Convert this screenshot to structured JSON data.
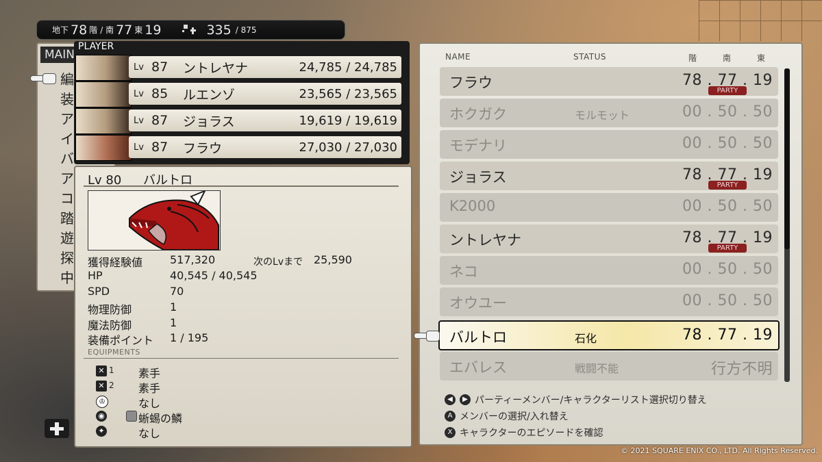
{
  "status_bar": {
    "floor_prefix": "地下",
    "floor": "78",
    "floor_suffix": "階",
    "south_prefix": "/ 南",
    "south": "77",
    "east_prefix": "東",
    "east": "19",
    "steps": "335",
    "steps_max": "/ 875"
  },
  "main_menu": {
    "header": "MAIN",
    "items": [
      "編",
      "装",
      "ア",
      "イ",
      "バ",
      "ア",
      "コ",
      "踏",
      "遊",
      "探",
      "中"
    ]
  },
  "player": {
    "label": "PLAYER",
    "rows": [
      {
        "lv_label": "Lv",
        "lv": "87",
        "name": "ントレヤナ",
        "hp": "24,785 / 24,785"
      },
      {
        "lv_label": "Lv",
        "lv": "85",
        "name": "ルエンゾ",
        "hp": "23,565 / 23,565"
      },
      {
        "lv_label": "Lv",
        "lv": "87",
        "name": "ジョラス",
        "hp": "19,619 / 19,619"
      },
      {
        "lv_label": "Lv",
        "lv": "87",
        "name": "フラウ",
        "hp": "27,030 / 27,030"
      }
    ]
  },
  "detail": {
    "lv_label": "Lv 80",
    "name": "バルトロ",
    "exp_label": "獲得経験値",
    "exp": "517,320",
    "next_label": "次のLvまで",
    "next": "25,590",
    "hp_label": "HP",
    "hp": "40,545 / 40,545",
    "spd_label": "SPD",
    "spd": "70",
    "pdef_label": "物理防御",
    "pdef": "1",
    "mdef_label": "魔法防御",
    "mdef": "1",
    "equip_pts_label": "装備ポイント",
    "equip_pts": "1 / 195",
    "equip_header": "EQUIPMENTS",
    "equips": [
      {
        "num": "1",
        "value": "素手"
      },
      {
        "num": "2",
        "value": "素手"
      },
      {
        "num": "",
        "value": "なし"
      },
      {
        "num": "",
        "value": "蜥蜴の鱗"
      },
      {
        "num": "",
        "value": "なし"
      }
    ]
  },
  "list": {
    "headers": {
      "name": "NAME",
      "status": "STATUS",
      "floor": "階",
      "south": "南",
      "east": "東"
    },
    "rows": [
      {
        "name": "フラウ",
        "status": "",
        "loc": "78 . 77 . 19",
        "party": "PARTY",
        "state": "active"
      },
      {
        "name": "ホクガク",
        "status": "モルモット",
        "loc": "00 . 50 . 50",
        "party": "",
        "state": "dim"
      },
      {
        "name": "モデナリ",
        "status": "",
        "loc": "00 . 50 . 50",
        "party": "",
        "state": "dim"
      },
      {
        "name": "ジョラス",
        "status": "",
        "loc": "78 . 77 . 19",
        "party": "PARTY",
        "state": "active"
      },
      {
        "name": "K2000",
        "status": "",
        "loc": "00 . 50 . 50",
        "party": "",
        "state": "dim"
      },
      {
        "name": "ントレヤナ",
        "status": "",
        "loc": "78 . 77 . 19",
        "party": "PARTY",
        "state": "active"
      },
      {
        "name": "ネコ",
        "status": "",
        "loc": "00 . 50 . 50",
        "party": "",
        "state": "dim"
      },
      {
        "name": "オウユー",
        "status": "",
        "loc": "00 . 50 . 50",
        "party": "",
        "state": "dim"
      },
      {
        "name": "バルトロ",
        "status": "石化",
        "loc": "78 . 77 . 19",
        "party": "",
        "state": "selected"
      },
      {
        "name": "エバレス",
        "status": "戦闘不能",
        "loc": "行方不明",
        "party": "",
        "state": "dim"
      }
    ],
    "help": [
      {
        "buttons": [
          "◀",
          "▶"
        ],
        "text": "パーティーメンバー/キャラクターリスト選択切り替え"
      },
      {
        "buttons": [
          "A"
        ],
        "text": "メンバーの選択/入れ替え"
      },
      {
        "buttons": [
          "X"
        ],
        "text": "キャラクターのエピソードを確認"
      }
    ]
  },
  "copyright": "© 2021 SQUARE ENIX CO., LTD. All Rights Reserved.",
  "colors": {
    "party_badge": "#8a2020",
    "selected_row": "#f5e7a8"
  }
}
